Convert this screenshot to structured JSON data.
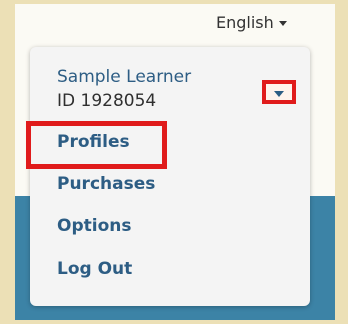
{
  "header": {
    "language_label": "English",
    "language_icon": "chevron-down-icon"
  },
  "user_menu": {
    "name": "Sample Learner",
    "id_text": "ID 1928054",
    "toggle_icon": "chevron-down-icon",
    "items": [
      {
        "label": "Profiles"
      },
      {
        "label": "Purchases"
      },
      {
        "label": "Options"
      },
      {
        "label": "Log Out"
      }
    ]
  },
  "colors": {
    "link": "#2d5d84",
    "highlight": "#e01b1b",
    "band": "#3c83a6",
    "frame": "#ece0b6"
  }
}
